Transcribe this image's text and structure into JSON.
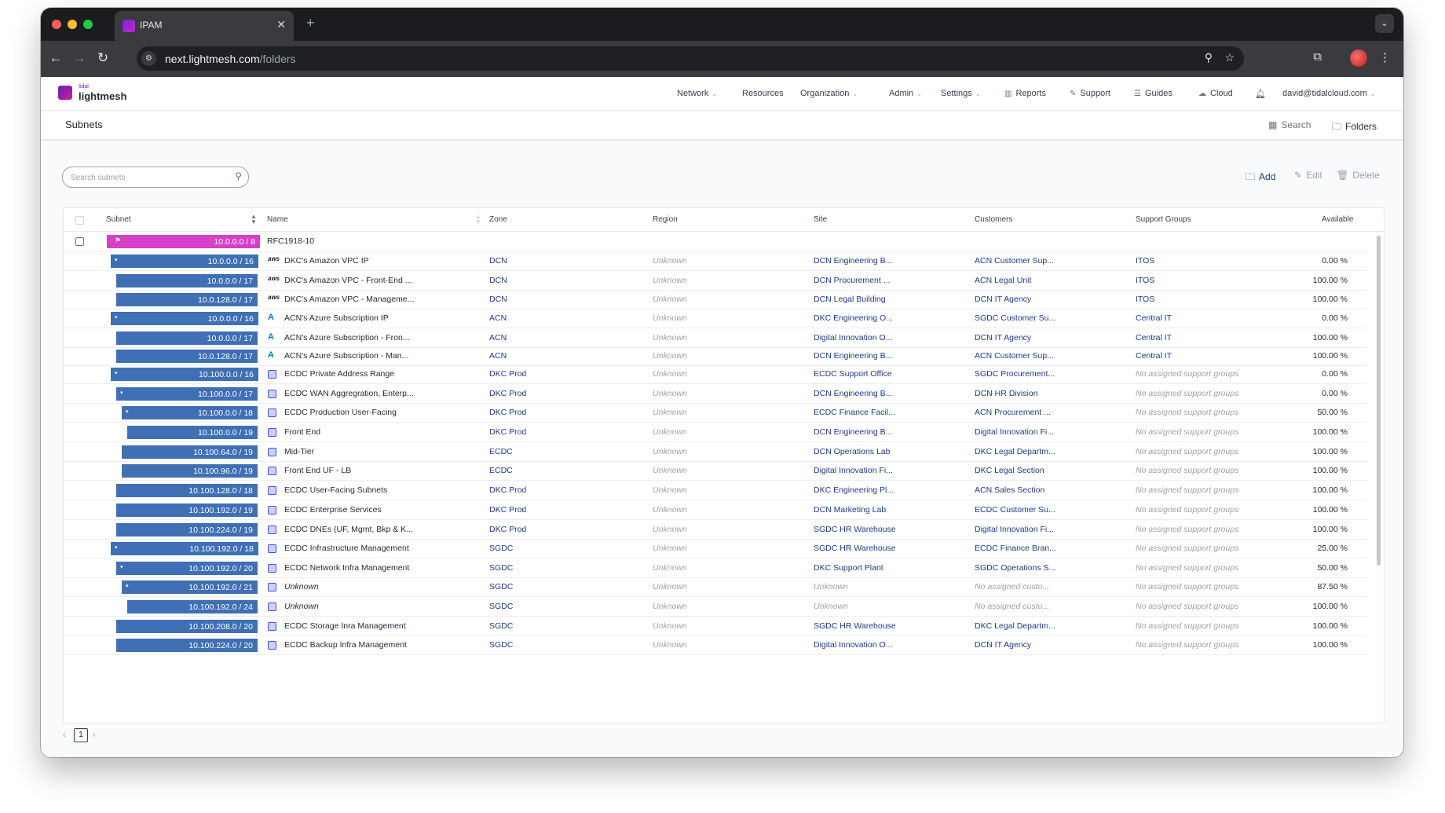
{
  "browser": {
    "tab_title": "IPAM",
    "tab_close": "✕",
    "new_tab": "+",
    "tab_menu": "⌄",
    "url_host": "next.lightmesh.com",
    "url_path": "/folders"
  },
  "app": {
    "logo_top": "tidal",
    "logo_main": "lightmesh",
    "nav": {
      "network": "Network",
      "resources": "Resources",
      "organization": "Organization",
      "admin": "Admin",
      "settings": "Settings",
      "reports": "Reports",
      "support": "Support",
      "guides": "Guides",
      "cloud": "Cloud",
      "user": "david@tidalcloud.com"
    },
    "page_title": "Subnets",
    "view_search": "Search",
    "view_folders": "Folders",
    "search_placeholder": "Search subnets",
    "actions": {
      "add": "Add",
      "edit": "Edit",
      "delete": "Delete"
    },
    "columns": {
      "subnet": "Subnet",
      "name": "Name",
      "zone": "Zone",
      "region": "Region",
      "site": "Site",
      "customers": "Customers",
      "support_groups": "Support Groups",
      "available": "Available"
    },
    "pagination": {
      "prev": "‹",
      "page": "1",
      "next": "›"
    },
    "colors": {
      "root_bar": "#d83fc9",
      "subnet_bar": "#3f6fb5",
      "link_text": "#1e3a8a",
      "muted_text": "#9ca3af"
    }
  },
  "rows": [
    {
      "subnet": "10.0.0.0 / 8",
      "name": "RFC1918-10",
      "icon": "folder",
      "zone": "",
      "region": "",
      "site": "",
      "customers": "",
      "support": "",
      "available": ""
    },
    {
      "subnet": "10.0.0.0 / 16",
      "name": "DKC's Amazon VPC IP",
      "icon": "aws",
      "zone": "DCN",
      "region": "Unknown",
      "site": "DCN Engineering B...",
      "customers": "ACN Customer Sup...",
      "support": "ITOS",
      "available": "0.00 %"
    },
    {
      "subnet": "10.0.0.0 / 17",
      "name": "DKC's Amazon VPC - Front-End ...",
      "icon": "aws",
      "zone": "DCN",
      "region": "Unknown",
      "site": "DCN Procurement ...",
      "customers": "ACN Legal Unit",
      "support": "ITOS",
      "available": "100.00 %"
    },
    {
      "subnet": "10.0.128.0 / 17",
      "name": "DKC's Amazon VPC - Manageme...",
      "icon": "aws",
      "zone": "DCN",
      "region": "Unknown",
      "site": "DCN Legal Building",
      "customers": "DCN IT Agency",
      "support": "ITOS",
      "available": "100.00 %"
    },
    {
      "subnet": "10.0.0.0 / 16",
      "name": "ACN's Azure Subscription IP",
      "icon": "azure",
      "zone": "ACN",
      "region": "Unknown",
      "site": "DKC Engineering O...",
      "customers": "SGDC Customer Su...",
      "support": "Central IT",
      "available": "0.00 %"
    },
    {
      "subnet": "10.0.0.0 / 17",
      "name": "ACN's Azure Subscription - Fron...",
      "icon": "azure",
      "zone": "ACN",
      "region": "Unknown",
      "site": "Digital Innovation O...",
      "customers": "DCN IT Agency",
      "support": "Central IT",
      "available": "100.00 %"
    },
    {
      "subnet": "10.0.128.0 / 17",
      "name": "ACN's Azure Subscription - Man...",
      "icon": "azure",
      "zone": "ACN",
      "region": "Unknown",
      "site": "DCN Engineering B...",
      "customers": "ACN Customer Sup...",
      "support": "Central IT",
      "available": "100.00 %"
    },
    {
      "subnet": "10.100.0.0 / 16",
      "name": "ECDC Private Address Range",
      "icon": "server",
      "zone": "DKC Prod",
      "region": "Unknown",
      "site": "ECDC Support Office",
      "customers": "SGDC Procurement...",
      "support": "No assigned support groups",
      "available": "0.00 %"
    },
    {
      "subnet": "10.100.0.0 / 17",
      "name": "ECDC WAN Aggregration, Enterp...",
      "icon": "server",
      "zone": "DKC Prod",
      "region": "Unknown",
      "site": "DCN Engineering B...",
      "customers": "DCN HR Division",
      "support": "No assigned support groups",
      "available": "0.00 %"
    },
    {
      "subnet": "10.100.0.0 / 18",
      "name": "ECDC Production User-Facing",
      "icon": "server",
      "zone": "DKC Prod",
      "region": "Unknown",
      "site": "ECDC Finance Facil...",
      "customers": "ACN Procurement ...",
      "support": "No assigned support groups",
      "available": "50.00 %"
    },
    {
      "subnet": "10.100.0.0 / 19",
      "name": "Front End",
      "icon": "server",
      "zone": "DKC Prod",
      "region": "Unknown",
      "site": "DCN Engineering B...",
      "customers": "Digital Innovation Fi...",
      "support": "No assigned support groups",
      "available": "100.00 %"
    },
    {
      "subnet": "10.100.64.0 / 19",
      "name": "Mid-Tier",
      "icon": "server",
      "zone": "ECDC",
      "region": "Unknown",
      "site": "DCN Operations Lab",
      "customers": "DKC Legal Departm...",
      "support": "No assigned support groups",
      "available": "100.00 %"
    },
    {
      "subnet": "10.100.96.0 / 19",
      "name": "Front End UF - LB",
      "icon": "server",
      "zone": "ECDC",
      "region": "Unknown",
      "site": "Digital Innovation Fi...",
      "customers": "DKC Legal Section",
      "support": "No assigned support groups",
      "available": "100.00 %"
    },
    {
      "subnet": "10.100.128.0 / 18",
      "name": "ECDC User-Facing Subnets",
      "icon": "server",
      "zone": "DKC Prod",
      "region": "Unknown",
      "site": "DKC Engineering Pl...",
      "customers": "ACN Sales Section",
      "support": "No assigned support groups",
      "available": "100.00 %"
    },
    {
      "subnet": "10.100.192.0 / 19",
      "name": "ECDC Enterprise Services",
      "icon": "server",
      "zone": "DKC Prod",
      "region": "Unknown",
      "site": "DCN Marketing Lab",
      "customers": "ECDC Customer Su...",
      "support": "No assigned support groups",
      "available": "100.00 %"
    },
    {
      "subnet": "10.100.224.0 / 19",
      "name": "ECDC DNEs (UF, Mgmt, Bkp & K...",
      "icon": "server",
      "zone": "DKC Prod",
      "region": "Unknown",
      "site": "SGDC HR Warehouse",
      "customers": "Digital Innovation Fi...",
      "support": "No assigned support groups",
      "available": "100.00 %"
    },
    {
      "subnet": "10.100.192.0 / 18",
      "name": "ECDC Infrastructure Management",
      "icon": "server",
      "zone": "SGDC",
      "region": "Unknown",
      "site": "SGDC HR Warehouse",
      "customers": "ECDC Finance Bran...",
      "support": "No assigned support groups",
      "available": "25.00 %"
    },
    {
      "subnet": "10.100.192.0 / 20",
      "name": "ECDC Network Infra Management",
      "icon": "server",
      "zone": "SGDC",
      "region": "Unknown",
      "site": "DKC Support Plant",
      "customers": "SGDC Operations S...",
      "support": "No assigned support groups",
      "available": "50.00 %"
    },
    {
      "subnet": "10.100.192.0 / 21",
      "name": "Unknown",
      "icon": "server",
      "zone": "SGDC",
      "region": "Unknown",
      "site": "Unknown",
      "customers": "No assigned custo...",
      "support": "No assigned support groups",
      "available": "87.50 %"
    },
    {
      "subnet": "10.100.192.0 / 24",
      "name": "Unknown",
      "icon": "server",
      "zone": "SGDC",
      "region": "Unknown",
      "site": "Unknown",
      "customers": "No assigned custo...",
      "support": "No assigned support groups",
      "available": "100.00 %"
    },
    {
      "subnet": "10.100.208.0 / 20",
      "name": "ECDC Storage Inra Management",
      "icon": "server",
      "zone": "SGDC",
      "region": "Unknown",
      "site": "SGDC HR Warehouse",
      "customers": "DKC Legal Departm...",
      "support": "No assigned support groups",
      "available": "100.00 %"
    },
    {
      "subnet": "10.100.224.0 / 20",
      "name": "ECDC Backup Infra Management",
      "icon": "server",
      "zone": "SGDC",
      "region": "Unknown",
      "site": "Digital Innovation O...",
      "customers": "DCN IT Agency",
      "support": "No assigned support groups",
      "available": "100.00 %"
    }
  ]
}
